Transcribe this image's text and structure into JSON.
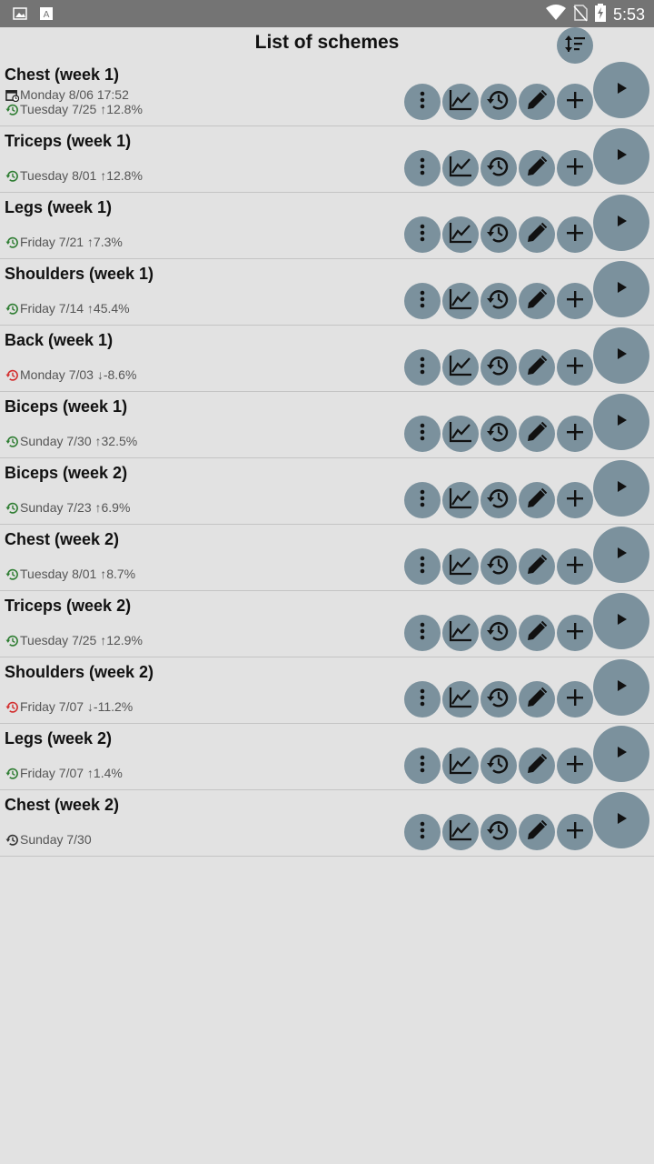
{
  "status_bar": {
    "time": "5:53",
    "left_icons": [
      "image-icon",
      "text-icon"
    ],
    "right_icons": [
      "wifi-icon",
      "no-sim-icon",
      "battery-charging-icon"
    ]
  },
  "header": {
    "title": "List of schemes",
    "sort_icon": "sort-icon"
  },
  "colors": {
    "button_bg": "#7b919d",
    "up_history": "#2e7d32",
    "down_history": "#d32f2f",
    "neutral_history": "#333333"
  },
  "schemes": [
    {
      "name": "Chest (week 1)",
      "scheduled": "Monday 8/06 17:52",
      "last": "Tuesday 7/25 ↑12.8%",
      "trend": "up"
    },
    {
      "name": "Triceps (week 1)",
      "scheduled": "",
      "last": "Tuesday 8/01 ↑12.8%",
      "trend": "up"
    },
    {
      "name": "Legs (week 1)",
      "scheduled": "",
      "last": "Friday 7/21 ↑7.3%",
      "trend": "up"
    },
    {
      "name": "Shoulders (week 1)",
      "scheduled": "",
      "last": "Friday 7/14 ↑45.4%",
      "trend": "up"
    },
    {
      "name": "Back (week 1)",
      "scheduled": "",
      "last": "Monday 7/03 ↓-8.6%",
      "trend": "down"
    },
    {
      "name": "Biceps (week 1)",
      "scheduled": "",
      "last": "Sunday 7/30 ↑32.5%",
      "trend": "up"
    },
    {
      "name": "Biceps (week 2)",
      "scheduled": "",
      "last": "Sunday 7/23 ↑6.9%",
      "trend": "up"
    },
    {
      "name": "Chest (week 2)",
      "scheduled": "",
      "last": "Tuesday 8/01 ↑8.7%",
      "trend": "up"
    },
    {
      "name": "Triceps (week 2)",
      "scheduled": "",
      "last": "Tuesday 7/25 ↑12.9%",
      "trend": "up"
    },
    {
      "name": "Shoulders (week 2)",
      "scheduled": "",
      "last": "Friday 7/07 ↓-11.2%",
      "trend": "down"
    },
    {
      "name": "Legs (week 2)",
      "scheduled": "",
      "last": "Friday 7/07 ↑1.4%",
      "trend": "up"
    },
    {
      "name": "Chest (week 2)",
      "scheduled": "",
      "last": "Sunday 7/30",
      "trend": "none"
    }
  ],
  "row_actions": [
    "more-icon",
    "chart-icon",
    "history-icon",
    "edit-icon",
    "add-icon",
    "play-icon"
  ]
}
